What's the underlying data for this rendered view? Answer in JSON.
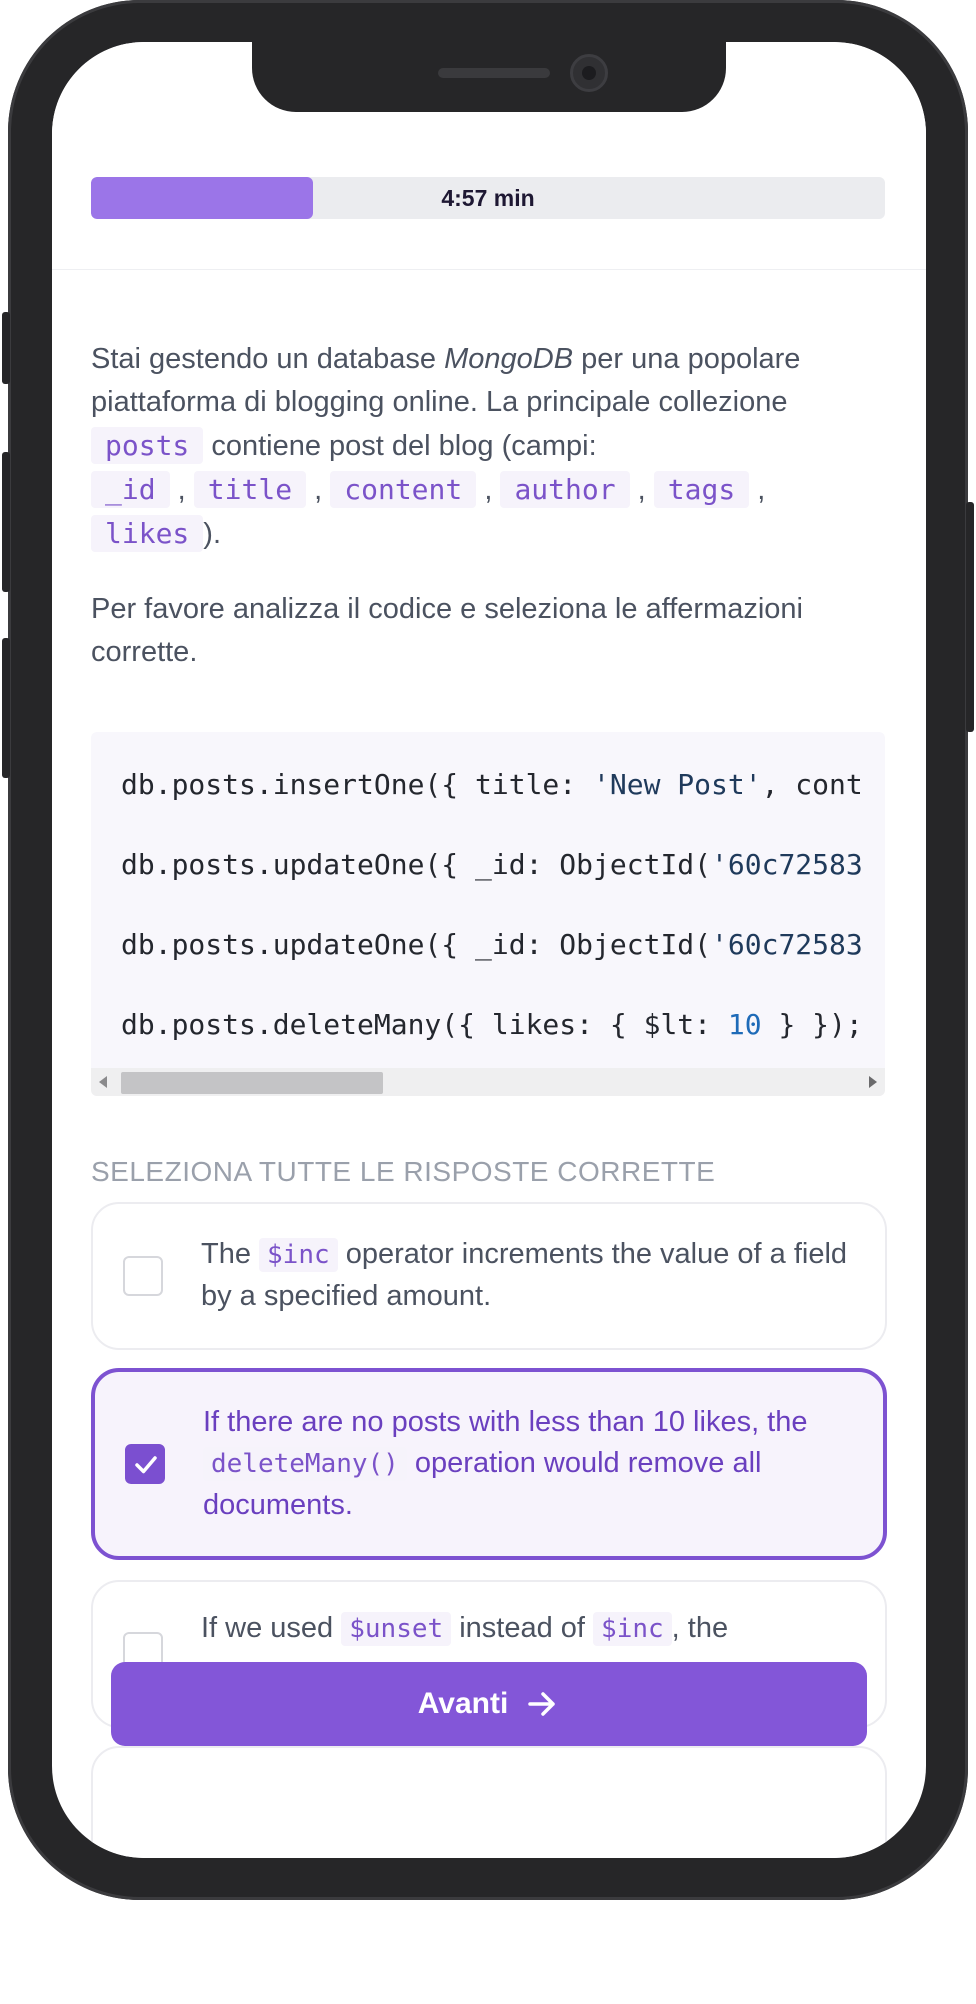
{
  "header": {
    "timer": "4:57 min",
    "progress_fraction": 0.28
  },
  "intro": {
    "p1_a": "Stai gestendo un database ",
    "p1_db": "MongoDB",
    "p1_b": " per una popolare piattaforma di blogging online. La principale collezione ",
    "collection": "posts",
    "p1_c": " contiene post del blog (campi: ",
    "fields": [
      "_id",
      "title",
      "content",
      "author",
      "tags",
      "likes"
    ],
    "sep": ",",
    "p1_end": ").",
    "p2": "Per favore analizza il codice e seleziona le affermazioni corrette."
  },
  "code": {
    "l1_a": "db.posts.insertOne({ title: ",
    "l1_str": "'New Post'",
    "l1_b": ", cont",
    "l2_a": "db.posts.updateOne({ _id: ObjectId(",
    "l2_str": "'60c72583",
    "l3_a": "db.posts.updateOne({ _id: ObjectId(",
    "l3_str": "'60c72583",
    "l4_a": "db.posts.deleteMany({ likes: { $lt: ",
    "l4_num": "10",
    "l4_b": " } });"
  },
  "answers": {
    "label": "Seleziona tutte le risposte corrette",
    "o1_a": "The ",
    "o1_code": "$inc",
    "o1_b": " operator increments the value of a field by a specified amount.",
    "o2_a": "If there are no posts with less than 10 likes, the ",
    "o2_code": "deleteMany()",
    "o2_b": " operation would remove all documents.",
    "o3_a": "If we used ",
    "o3_code1": "$unset",
    "o3_b": " instead of ",
    "o3_code2": "$inc",
    "o3_c": ", the"
  },
  "footer": {
    "next_label": "Avanti"
  },
  "colors": {
    "accent": "#8356d8",
    "progress": "#9b75e8"
  }
}
